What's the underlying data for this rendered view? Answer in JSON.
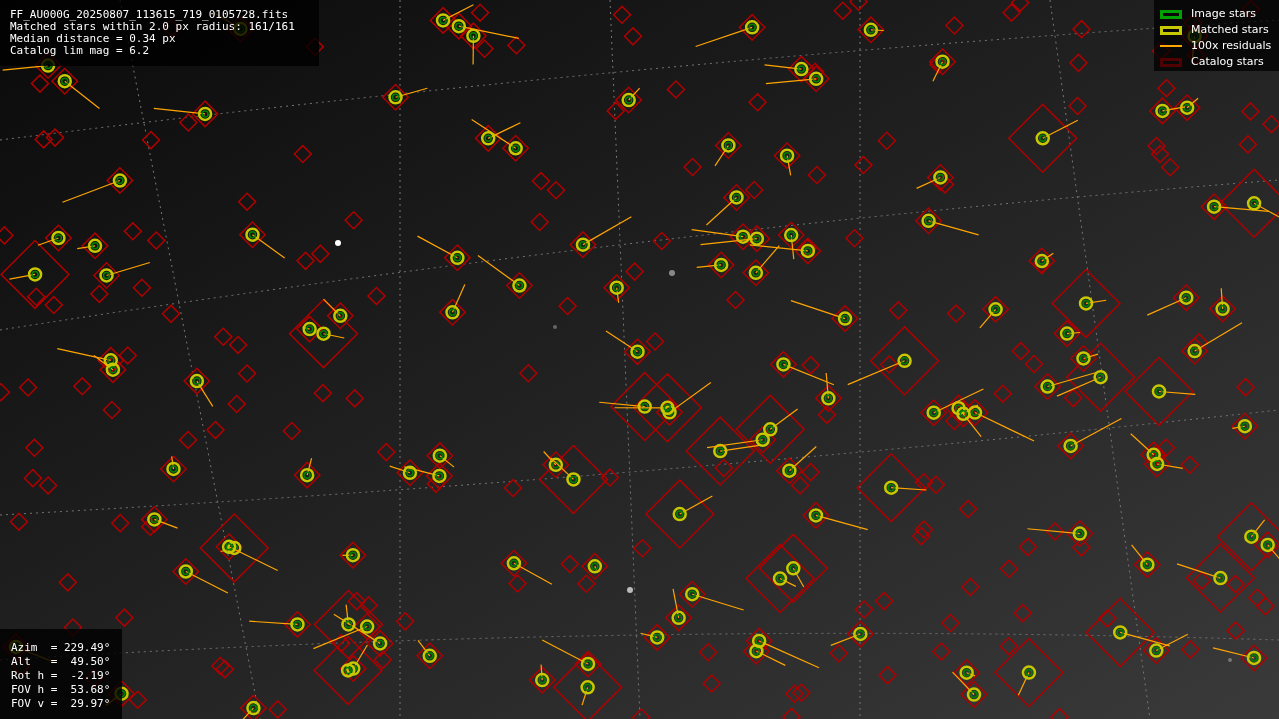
{
  "info_box": {
    "lines": [
      "FF_AU000G_20250807_113615_719_0105728.fits",
      "Matched stars within 2.0 px radius: 161/161",
      "Median distance = 0.34 px",
      "Catalog lim mag = 6.2"
    ]
  },
  "legend": {
    "items": [
      {
        "label": "Image stars",
        "kind": "box",
        "color": "#00a000"
      },
      {
        "label": "Matched stars",
        "kind": "box",
        "color": "#c8c800"
      },
      {
        "label": "100x residuals",
        "kind": "line",
        "color": "#ffa500"
      },
      {
        "label": "Catalog stars",
        "kind": "diamond",
        "color": "#500000"
      }
    ]
  },
  "pointing_box": {
    "lines": [
      "Azim  = 229.49°",
      "Alt   =  49.50°",
      "Rot h =  -2.19°",
      "FOV h =  53.68°",
      "FOV v =  29.97°"
    ]
  }
}
